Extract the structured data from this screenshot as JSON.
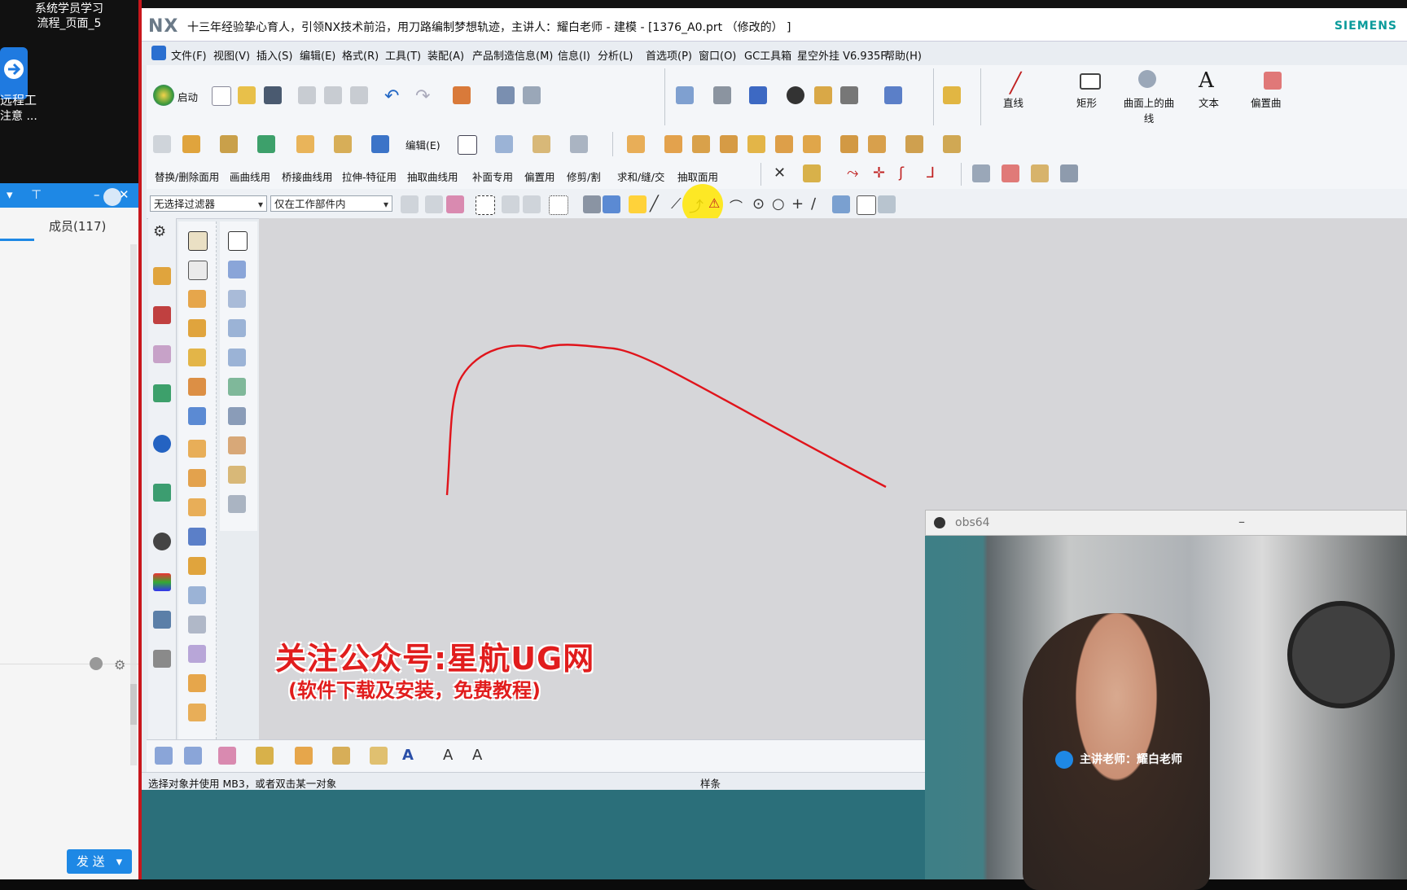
{
  "desktop": {
    "line1": "系统学员学习",
    "line2": "流程_页面_5",
    "remote_line1": "远程工",
    "remote_line2": "注意 ..."
  },
  "chat": {
    "members_label": "成员(117)",
    "send_label": "发 送"
  },
  "nx": {
    "logo": "NX",
    "title": "十三年经验挚心育人，引领NX技术前沿，用刀路编制梦想轨迹，主讲人：耀白老师 - 建模 - [1376_A0.prt （修改的） ]",
    "brand": "SIEMENS",
    "menu": [
      "文件(F)",
      "视图(V)",
      "插入(S)",
      "编辑(E)",
      "格式(R)",
      "工具(T)",
      "装配(A)",
      "产品制造信息(M)",
      "信息(I)",
      "分析(L)",
      "首选项(P)",
      "窗口(O)",
      "GC工具箱",
      "星空外挂 V6.935F",
      "帮助(H)"
    ],
    "ribbon1": {
      "start_label": "启动",
      "line_label": "直线",
      "rect_label": "矩形",
      "curve_on_surface_label": "曲面上的曲线",
      "text_label": "文本",
      "offset_label": "偏置曲"
    },
    "ribbon2": {
      "edit_label": "编辑(E)"
    },
    "ribbon3": [
      "替换/删除面用",
      "画曲线用",
      "桥接曲线用",
      "拉伸-特征用",
      "抽取曲线用",
      "补面专用",
      "偏置用",
      "修剪/割",
      "求和/缝/交",
      "抽取面用"
    ],
    "selection": {
      "filter": "无选择过滤器",
      "scope": "仅在工作部件内"
    },
    "graphics": {
      "watermark_main": "关注公众号:星航UG网",
      "watermark_sub": "(软件下载及安装，免费教程)",
      "curve_color": "#e0141b"
    },
    "status": {
      "prompt": "选择对象并使用 MB3，或者双击某一对象",
      "type": "样条"
    }
  },
  "webcam": {
    "window_title": "obs64",
    "lower_third": "主讲老师：耀白老师"
  }
}
